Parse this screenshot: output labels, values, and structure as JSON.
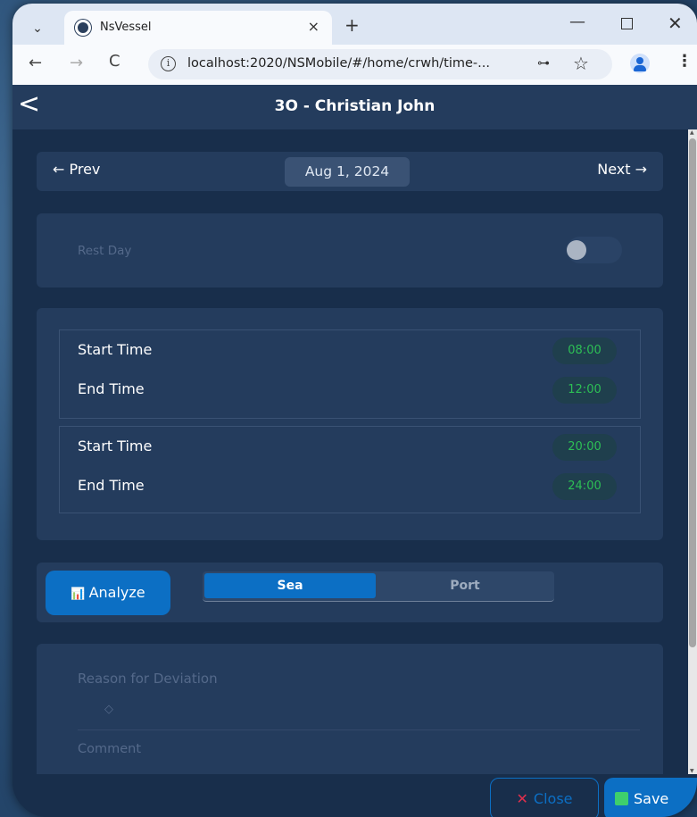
{
  "browser": {
    "tab_title": "NsVessel",
    "tab_close": "×",
    "new_tab": "+",
    "minimize": "—",
    "close_window": "✕",
    "url": "localhost:2020/NSMobile/#/home/crwh/time-...",
    "back": "←",
    "forward": "→",
    "reload": "C",
    "info": "i",
    "key": "⊶",
    "star": "☆",
    "menu": "⋮"
  },
  "header": {
    "back": "<",
    "title": "3O - Christian John"
  },
  "datebar": {
    "prev": "← Prev",
    "date": "Aug 1, 2024",
    "next": "Next →"
  },
  "rest_day": {
    "label": "Rest Day",
    "enabled": false
  },
  "time_ranges": [
    {
      "start_label": "Start Time",
      "start": "08:00",
      "end_label": "End Time",
      "end": "12:00"
    },
    {
      "start_label": "Start Time",
      "start": "20:00",
      "end_label": "End Time",
      "end": "24:00"
    }
  ],
  "analyze": {
    "icon": "📊",
    "label": "Analyze",
    "segments": [
      "Sea",
      "Port"
    ],
    "selected": "Sea"
  },
  "form": {
    "reason_label": "Reason for Deviation",
    "reason_select_icon": "◇",
    "comment_label": "Comment"
  },
  "footer": {
    "close_icon": "✕",
    "close_label": "Close",
    "save_label": "Save"
  },
  "colors": {
    "accent": "#0c6fc4",
    "time_text": "#2dbf55",
    "close_x": "#e0304d",
    "save_icon": "#3ecf6c"
  }
}
